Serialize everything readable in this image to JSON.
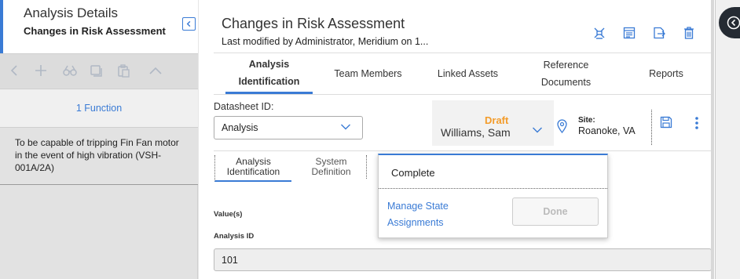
{
  "left_panel": {
    "title": "Analysis Details",
    "subtitle": "Changes in Risk Assessment",
    "function_header": "1 Function",
    "function_item": "To be capable of tripping Fin Fan motor in the event of high vibration (VSH-001A/2A)"
  },
  "main": {
    "title": "Changes in Risk Assessment",
    "subtitle": "Last modified by Administrator, Meridium on 1..."
  },
  "tabs": {
    "analysis_line1": "Analysis",
    "analysis_line2": "Identification",
    "team": "Team Members",
    "linked": "Linked Assets",
    "reference_line1": "Reference",
    "reference_line2": "Documents",
    "reports": "Reports"
  },
  "datasheet": {
    "label": "Datasheet ID:",
    "value": "Analysis"
  },
  "state": {
    "label": "Draft",
    "user": "Williams, Sam",
    "color": "#f39c2b"
  },
  "site": {
    "label": "Site:",
    "value": "Roanoke, VA"
  },
  "subtabs": {
    "analysis_line1": "Analysis",
    "analysis_line2": "Identification",
    "system_line1": "System",
    "system_line2": "Definition"
  },
  "form": {
    "values_label": "Value(s)",
    "analysis_id_label": "Analysis ID",
    "analysis_id_value": "101"
  },
  "popup": {
    "complete": "Complete",
    "manage_line1": "Manage State",
    "manage_line2": "Assignments",
    "done": "Done"
  },
  "colors": {
    "accent": "#3a7bd5",
    "dark_rail": "#252b33"
  }
}
